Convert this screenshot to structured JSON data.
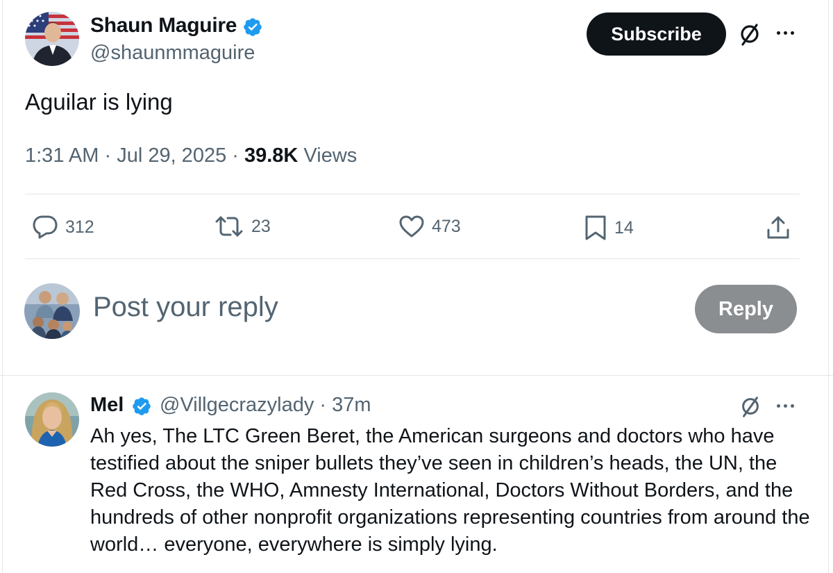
{
  "tweet": {
    "author": {
      "name": "Shaun Maguire",
      "handle": "@shaunmmaguire",
      "avatar_icon": "person-flag-avatar"
    },
    "subscribe_label": "Subscribe",
    "text": "Aguilar is lying",
    "time": "1:31 AM",
    "separator": " · ",
    "date": "Jul 29, 2025",
    "views_count": "39.8K",
    "views_label": " Views",
    "stats": {
      "replies": "312",
      "reposts": "23",
      "likes": "473",
      "bookmarks": "14"
    }
  },
  "composer": {
    "placeholder": "Post your reply",
    "reply_label": "Reply",
    "avatar_icon": "group-photo-avatar"
  },
  "reply": {
    "name": "Mel",
    "handle": "@Villgecrazylady",
    "time": "37m",
    "separator": " · ",
    "text": "Ah yes, The LTC Green Beret, the American surgeons and doctors who have testified about the sniper bullets they’ve seen in children’s heads, the UN, the Red Cross, the WHO, Amnesty International, Doctors Without Borders, and the hundreds of other nonprofit organizations representing countries from around the world… everyone, everywhere is simply lying."
  },
  "colors": {
    "text": "#0f1419",
    "secondary": "#536471",
    "verified": "#1d9bf0",
    "subscribe_bg": "#0f1419",
    "reply_button_disabled": "#8a8e91"
  }
}
